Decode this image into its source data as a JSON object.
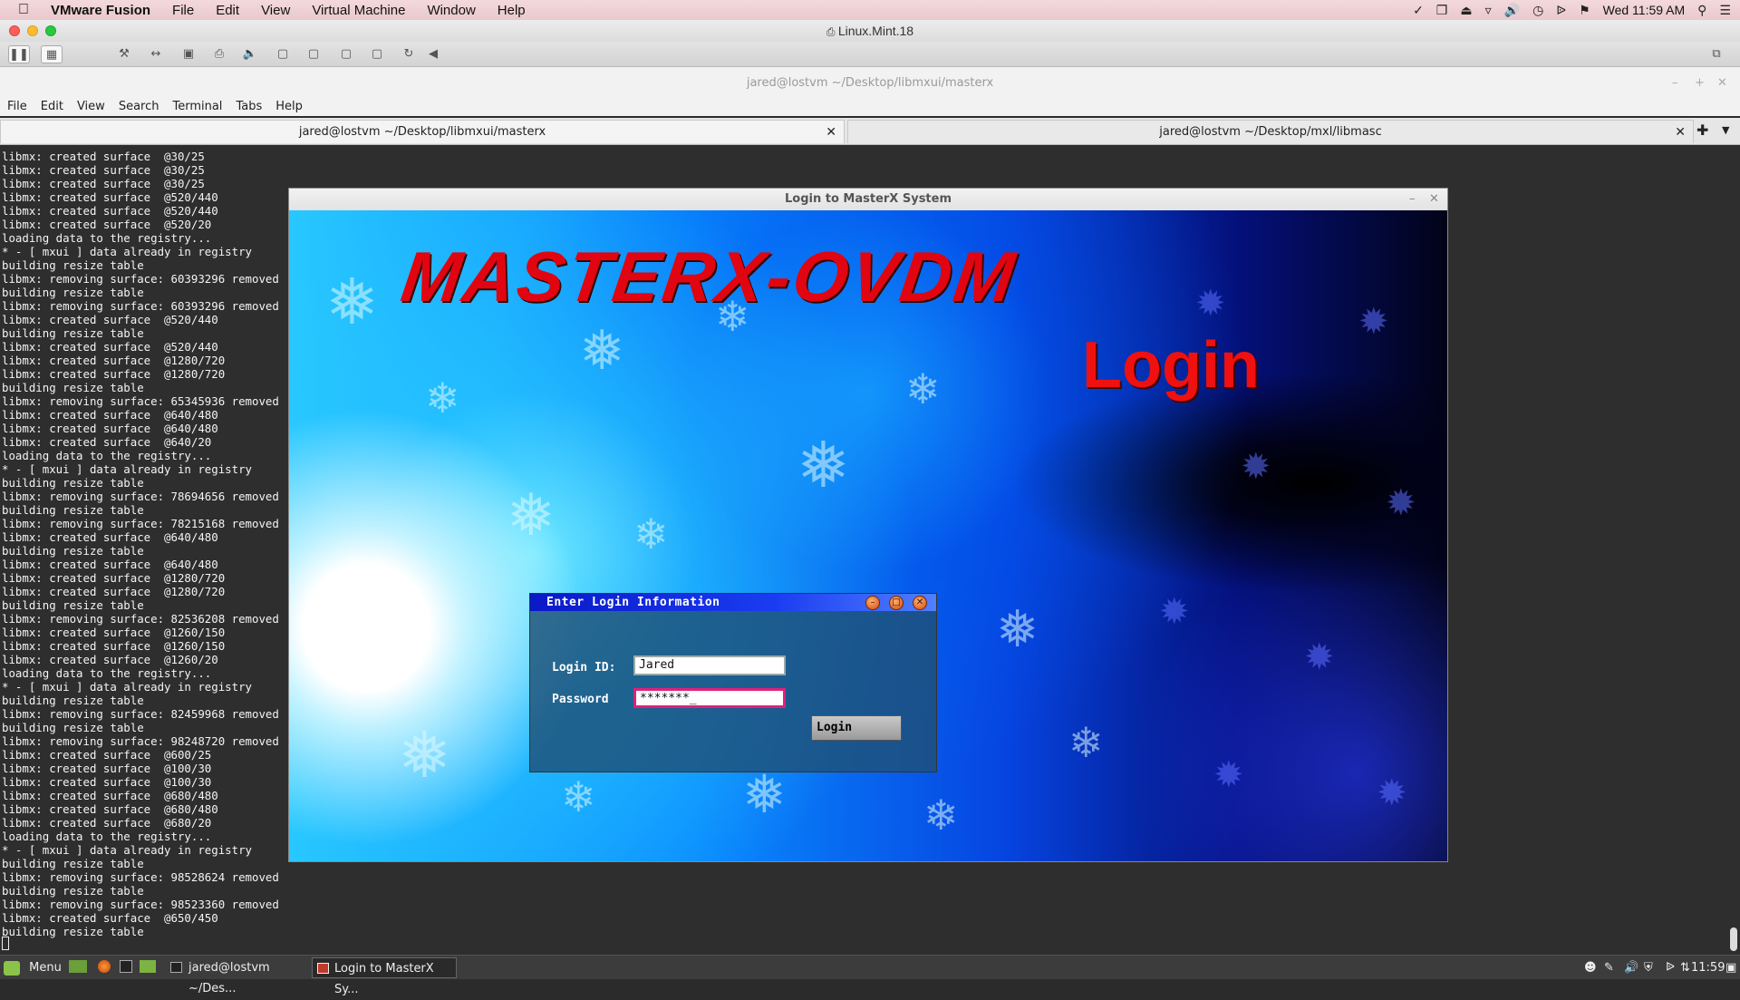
{
  "mac_menubar": {
    "app": "VMware Fusion",
    "items": [
      "File",
      "Edit",
      "View",
      "Virtual Machine",
      "Window",
      "Help"
    ],
    "clock": "Wed 11:59 AM"
  },
  "vmware": {
    "title": "Linux.Mint.18"
  },
  "terminal": {
    "title": "jared@lostvm ~/Desktop/libmxui/masterx",
    "menu": [
      "File",
      "Edit",
      "View",
      "Search",
      "Terminal",
      "Tabs",
      "Help"
    ],
    "tabs": [
      {
        "label": "jared@lostvm ~/Desktop/libmxui/masterx"
      },
      {
        "label": "jared@lostvm ~/Desktop/mxl/libmasc"
      }
    ],
    "lines": [
      "libmx: created surface  @30/25",
      "libmx: created surface  @30/25",
      "libmx: created surface  @30/25",
      "libmx: created surface  @520/440",
      "libmx: created surface  @520/440",
      "libmx: created surface  @520/20",
      "loading data to the registry...",
      "* - [ mxui ] data already in registry",
      "building resize table",
      "libmx: removing surface: 60393296 removed",
      "building resize table",
      "libmx: removing surface: 60393296 removed",
      "libmx: created surface  @520/440",
      "building resize table",
      "libmx: created surface  @520/440",
      "libmx: created surface  @1280/720",
      "libmx: created surface  @1280/720",
      "building resize table",
      "libmx: removing surface: 65345936 removed",
      "libmx: created surface  @640/480",
      "libmx: created surface  @640/480",
      "libmx: created surface  @640/20",
      "loading data to the registry...",
      "* - [ mxui ] data already in registry",
      "building resize table",
      "libmx: removing surface: 78694656 removed",
      "building resize table",
      "libmx: removing surface: 78215168 removed",
      "libmx: created surface  @640/480",
      "building resize table",
      "libmx: created surface  @640/480",
      "libmx: created surface  @1280/720",
      "libmx: created surface  @1280/720",
      "building resize table",
      "libmx: removing surface: 82536208 removed",
      "libmx: created surface  @1260/150",
      "libmx: created surface  @1260/150",
      "libmx: created surface  @1260/20",
      "loading data to the registry...",
      "* - [ mxui ] data already in registry",
      "building resize table",
      "libmx: removing surface: 82459968 removed",
      "building resize table",
      "libmx: removing surface: 98248720 removed",
      "libmx: created surface  @600/25",
      "libmx: created surface  @100/30",
      "libmx: created surface  @100/30",
      "libmx: created surface  @680/480",
      "libmx: created surface  @680/480",
      "libmx: created surface  @680/20",
      "loading data to the registry...",
      "* - [ mxui ] data already in registry",
      "building resize table",
      "libmx: removing surface: 98528624 removed",
      "building resize table",
      "libmx: removing surface: 98523360 removed",
      "libmx: created surface  @650/450",
      "building resize table"
    ]
  },
  "masterx": {
    "window_title": "Login to MasterX System",
    "banner": "MASTERX-OVDM",
    "login_heading": "Login",
    "dialog": {
      "title": "Enter Login Information",
      "login_id_label": "Login ID:",
      "login_id_value": "Jared",
      "password_label": "Password",
      "password_value": "*******_",
      "login_button": "Login"
    }
  },
  "taskbar": {
    "menu": "Menu",
    "tasks": [
      {
        "label": "jared@lostvm ~/Des..."
      },
      {
        "label": "Login to MasterX Sy..."
      }
    ],
    "clock": "11:59"
  }
}
